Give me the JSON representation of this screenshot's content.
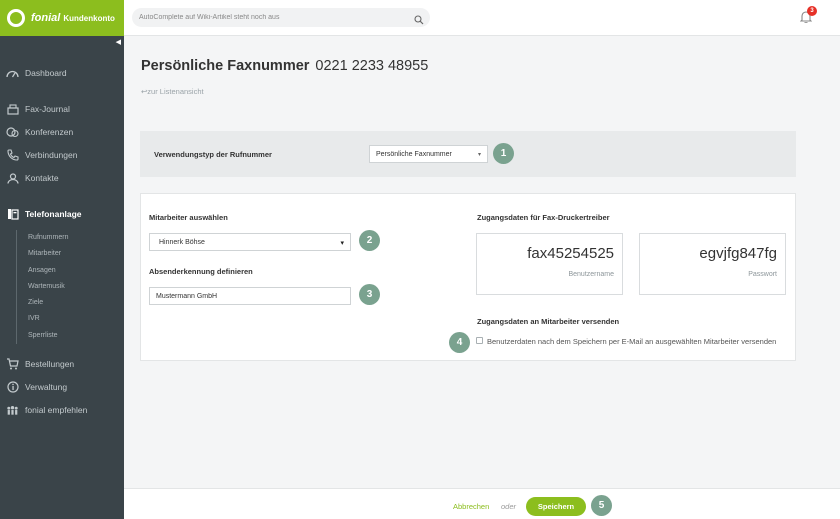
{
  "brand": {
    "name": "fonial",
    "subtitle": "Kundenkonto",
    "accent": "#8cbe1e",
    "sidebar_bg": "#3a4449"
  },
  "search": {
    "placeholder": "AutoComplete auf Wiki-Artikel steht noch aus"
  },
  "notifications": {
    "count": "3"
  },
  "sidebar": {
    "items": [
      {
        "label": "Dashboard",
        "icon": "dashboard-icon"
      },
      {
        "label": "Fax-Journal",
        "icon": "fax-icon"
      },
      {
        "label": "Konferenzen",
        "icon": "conference-icon"
      },
      {
        "label": "Verbindungen",
        "icon": "phone-icon"
      },
      {
        "label": "Kontakte",
        "icon": "contacts-icon"
      },
      {
        "label": "Telefonanlage",
        "icon": "pbx-icon",
        "active": true
      },
      {
        "label": "Bestellungen",
        "icon": "cart-icon"
      },
      {
        "label": "Verwaltung",
        "icon": "info-icon"
      },
      {
        "label": "fonial empfehlen",
        "icon": "people-icon"
      }
    ],
    "subitems": [
      "Rufnummern",
      "Mitarbeiter",
      "Ansagen",
      "Wartemusik",
      "Ziele",
      "IVR",
      "Sperrliste"
    ]
  },
  "page": {
    "title": "Persönliche Faxnummer",
    "number": "0221 2233 48955",
    "back_link": "zur Listenansicht"
  },
  "usage": {
    "label": "Verwendungstyp der Rufnummer",
    "selected": "Persönliche Faxnummer"
  },
  "employee": {
    "label": "Mitarbeiter auswählen",
    "selected": "Hinnerk Böhse"
  },
  "sender": {
    "label": "Absenderkennung definieren",
    "value": "Mustermann GmbH"
  },
  "credentials": {
    "label": "Zugangsdaten für Fax-Druckertreiber",
    "username": "fax45254525",
    "username_caption": "Benutzername",
    "password": "egvjfg847fg",
    "password_caption": "Passwort"
  },
  "send": {
    "label": "Zugangsdaten an Mitarbeiter versenden",
    "checkbox_label": "Benutzerdaten nach dem Speichern per E-Mail an ausgewählten Mitarbeiter versenden"
  },
  "steps": [
    "1",
    "2",
    "3",
    "4",
    "5"
  ],
  "footer": {
    "cancel": "Abbrechen",
    "or": "oder",
    "save": "Speichern"
  }
}
